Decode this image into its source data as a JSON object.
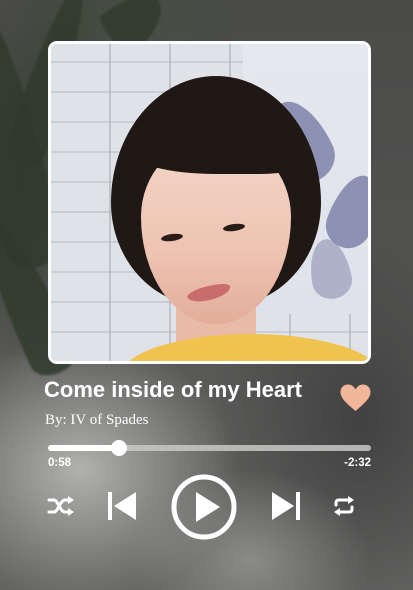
{
  "song": {
    "title": "Come inside of my Heart",
    "artist": "By: IV of Spades",
    "liked": true
  },
  "playback": {
    "elapsed": "0:58",
    "remaining": "-2:32",
    "progress": 0.22,
    "state": "paused"
  },
  "controls": {
    "shuffle_icon": "shuffle-icon",
    "previous_icon": "skip-previous-icon",
    "play_icon": "play-icon",
    "next_icon": "skip-next-icon",
    "repeat_icon": "repeat-icon"
  },
  "colors": {
    "accent_heart": "#f2b69b",
    "foreground": "#ffffff",
    "track": "#c8c8c6"
  }
}
